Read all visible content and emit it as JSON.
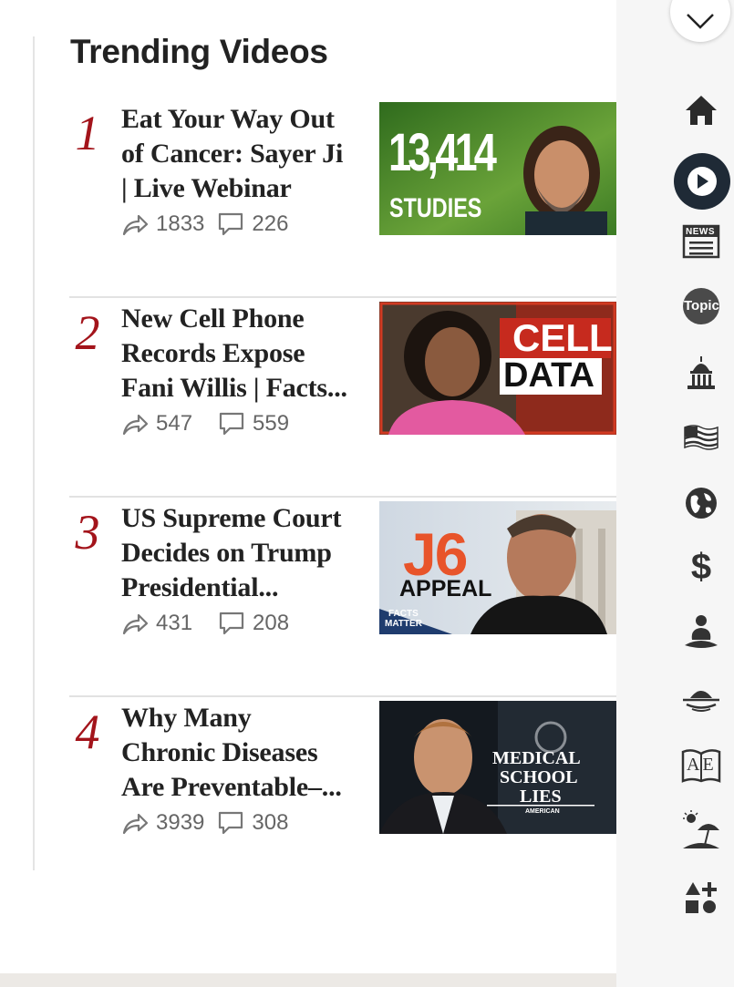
{
  "section": {
    "title": "Trending Videos"
  },
  "videos": [
    {
      "rank": "1",
      "title_lines": [
        "Eat Your Way Out",
        "of Cancer: Sayer Ji",
        "| Live Webinar"
      ],
      "shares": "1833",
      "comments": "226",
      "thumb": {
        "main_text": "13,414",
        "sub_text": "STUDIES"
      }
    },
    {
      "rank": "2",
      "title_lines": [
        "New Cell Phone",
        "Records Expose",
        "Fani Willis | Facts..."
      ],
      "shares": "547",
      "comments": "559",
      "thumb": {
        "main_text": "CELL",
        "sub_text": "DATA"
      }
    },
    {
      "rank": "3",
      "title_lines": [
        "US Supreme Court",
        "Decides on Trump",
        "Presidential..."
      ],
      "shares": "431",
      "comments": "208",
      "thumb": {
        "main_text": "J6",
        "sub_text": "APPEAL",
        "badge_line1": "FACTS",
        "badge_line2": "MATTER"
      }
    },
    {
      "rank": "4",
      "title_lines": [
        "Why Many",
        "Chronic Diseases",
        "Are Preventable–..."
      ],
      "shares": "3939",
      "comments": "308",
      "thumb": {
        "line1": "MEDICAL",
        "line2": "SCHOOL",
        "line3": "LIES",
        "brand": "AMERICAN"
      }
    }
  ],
  "sidebar": {
    "icons": [
      "chevron-down-icon",
      "home-icon",
      "play-icon",
      "newspaper-icon",
      "topic-icon",
      "capitol-icon",
      "us-flag-icon",
      "globe-icon",
      "dollar-icon",
      "meditation-icon",
      "sunset-icon",
      "book-icon",
      "beach-icon",
      "more-categories-icon"
    ],
    "news_label": "NEWS",
    "topic_label": "Topic",
    "dollar_label": "$",
    "book_label": "AE"
  },
  "colors": {
    "rank": "#a3141b",
    "title": "#222222",
    "stats": "#666666",
    "active_icon": "#1f2a36"
  }
}
